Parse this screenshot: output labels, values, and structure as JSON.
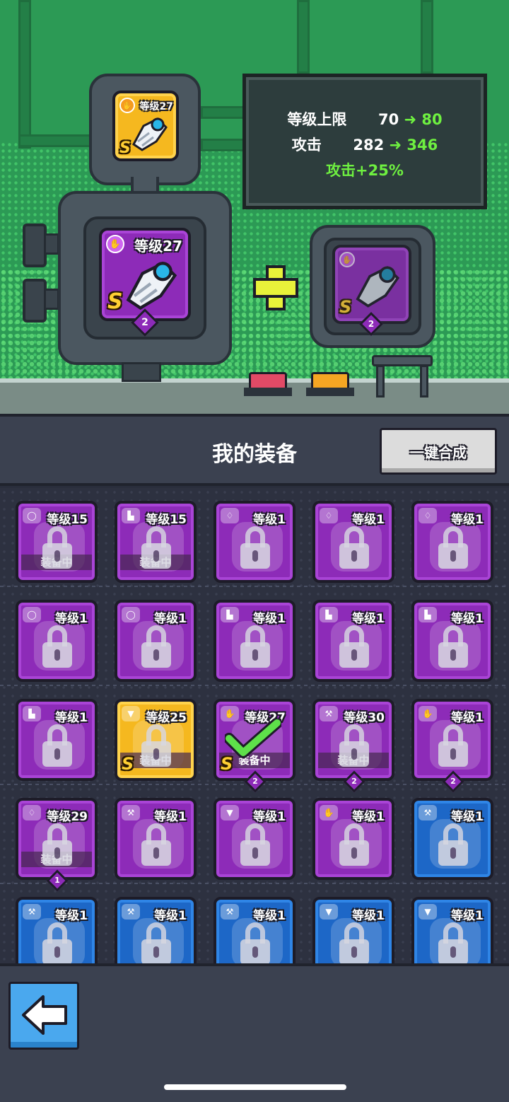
{
  "forge": {
    "top_item": {
      "level_label": "等级27",
      "grade": "S",
      "frame": "gold"
    },
    "main_item": {
      "level_label": "等级27",
      "grade": "S",
      "stars": "2",
      "frame": "purple"
    },
    "material_item": {
      "grade": "S",
      "stars": "2",
      "frame": "purple"
    },
    "info": {
      "level_cap_label": "等级上限",
      "level_cap_from": "70",
      "level_cap_to": "80",
      "attack_label": "攻击",
      "attack_from": "282",
      "attack_to": "346",
      "bonus": "攻击+25%"
    }
  },
  "header": {
    "title": "我的装备",
    "merge_button": "一键合成"
  },
  "colors": {
    "purple": "#8d2bb8",
    "gold": "#f5b81f",
    "blue": "#1d67c7",
    "green": "#6ef040"
  },
  "equipment": [
    {
      "level": "等级15",
      "frame": "purple",
      "slot": "belt-icon",
      "equipped": "装备中",
      "locked": true
    },
    {
      "level": "等级15",
      "frame": "purple",
      "slot": "boot-icon",
      "equipped": "装备中",
      "locked": true
    },
    {
      "level": "等级1",
      "frame": "purple",
      "slot": "ring-icon",
      "locked": true
    },
    {
      "level": "等级1",
      "frame": "purple",
      "slot": "ring-icon",
      "locked": true
    },
    {
      "level": "等级1",
      "frame": "purple",
      "slot": "ring-icon",
      "locked": true
    },
    {
      "level": "等级1",
      "frame": "purple",
      "slot": "belt-icon",
      "locked": true
    },
    {
      "level": "等级1",
      "frame": "purple",
      "slot": "belt-icon",
      "locked": true
    },
    {
      "level": "等级1",
      "frame": "purple",
      "slot": "boot-icon",
      "locked": true
    },
    {
      "level": "等级1",
      "frame": "purple",
      "slot": "boot-icon",
      "locked": true
    },
    {
      "level": "等级1",
      "frame": "purple",
      "slot": "boot-icon",
      "locked": true
    },
    {
      "level": "等级1",
      "frame": "purple",
      "slot": "boot-icon",
      "locked": true
    },
    {
      "level": "等级25",
      "frame": "gold",
      "slot": "armor-icon",
      "equipped": "装备中",
      "grade": "S",
      "locked": true
    },
    {
      "level": "等级27",
      "frame": "purple",
      "slot": "glove-icon",
      "equipped": "装备中",
      "grade": "S",
      "stars": "2",
      "selected": true
    },
    {
      "level": "等级30",
      "frame": "purple",
      "slot": "weapon-icon",
      "equipped": "装备中",
      "stars": "2",
      "locked": true
    },
    {
      "level": "等级1",
      "frame": "purple",
      "slot": "glove-icon",
      "stars": "2",
      "locked": true
    },
    {
      "level": "等级29",
      "frame": "purple",
      "slot": "ring-icon",
      "equipped": "装备中",
      "stars": "1",
      "locked": true
    },
    {
      "level": "等级1",
      "frame": "purple",
      "slot": "weapon-icon",
      "locked": true
    },
    {
      "level": "等级1",
      "frame": "purple",
      "slot": "armor-icon",
      "locked": true
    },
    {
      "level": "等级1",
      "frame": "purple",
      "slot": "glove-icon",
      "locked": true
    },
    {
      "level": "等级1",
      "frame": "blue",
      "slot": "weapon-icon",
      "locked": true
    },
    {
      "level": "等级1",
      "frame": "blue",
      "slot": "weapon-icon",
      "locked": true
    },
    {
      "level": "等级1",
      "frame": "blue",
      "slot": "weapon-icon",
      "locked": true
    },
    {
      "level": "等级1",
      "frame": "blue",
      "slot": "weapon-icon",
      "locked": true
    },
    {
      "level": "等级1",
      "frame": "blue",
      "slot": "armor-icon",
      "locked": true
    },
    {
      "level": "等级1",
      "frame": "blue",
      "slot": "armor-icon",
      "locked": true
    }
  ],
  "nav": {
    "back_icon": "arrow-left-icon"
  }
}
